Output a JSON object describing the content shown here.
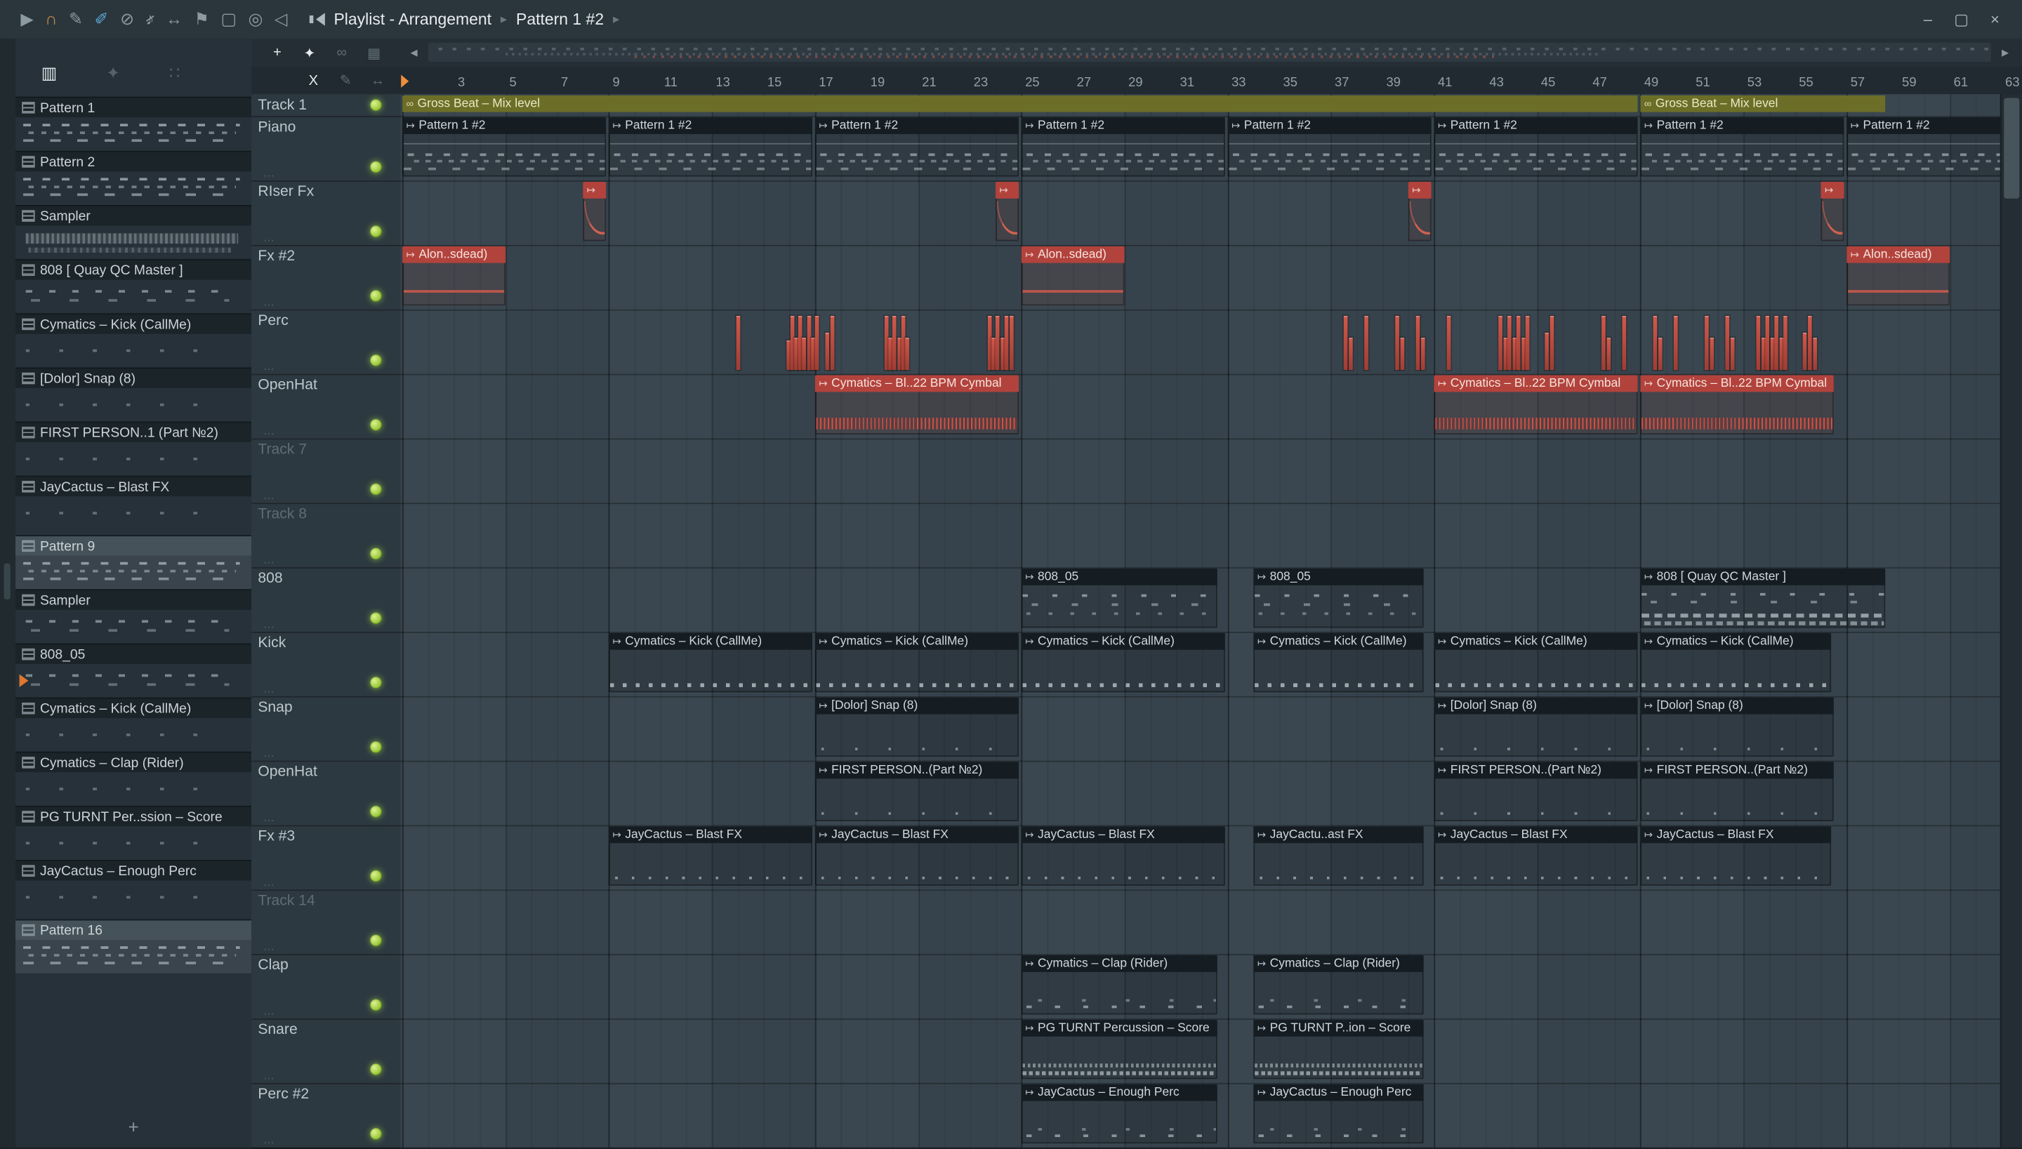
{
  "titlebar": {
    "breadcrumb": "Playlist - Arrangement",
    "crumb_sep": "▸",
    "breadcrumb2": "Pattern 1 #2",
    "tools": [
      {
        "name": "play-icon",
        "glyph": "▶",
        "color": "#8d9aa1"
      },
      {
        "name": "magnet-snap-icon",
        "glyph": "∩",
        "color": "#c78f4a"
      },
      {
        "name": "draw-tool-icon",
        "glyph": "✎",
        "color": "#8d9aa1"
      },
      {
        "name": "paint-tool-icon",
        "glyph": "✐",
        "color": "#5aa7d4",
        "bright": true
      },
      {
        "name": "delete-tool-icon",
        "glyph": "⊘",
        "color": "#8d9aa1"
      },
      {
        "name": "mute-tool-icon",
        "glyph": "♪",
        "color": "#8d9aa1",
        "slash": true
      },
      {
        "name": "slip-tool-icon",
        "glyph": "↔",
        "color": "#8d9aa1"
      },
      {
        "name": "playback-marker-icon",
        "glyph": "⚑",
        "color": "#8d9aa1"
      },
      {
        "name": "select-tool-icon",
        "glyph": "▢",
        "color": "#8d9aa1"
      },
      {
        "name": "zoom-tool-icon",
        "glyph": "◎",
        "color": "#8d9aa1"
      },
      {
        "name": "preview-speaker-icon",
        "glyph": "◁",
        "color": "#8d9aa1"
      }
    ],
    "window_buttons": [
      {
        "name": "minimize-button",
        "glyph": "–"
      },
      {
        "name": "maximize-button",
        "glyph": "▢"
      },
      {
        "name": "close-button",
        "glyph": "×"
      }
    ]
  },
  "sidebar": {
    "tools": [
      {
        "name": "pattern-grid-icon",
        "glyph": "▥",
        "bright": true
      },
      {
        "name": "star-icon",
        "glyph": "✦"
      },
      {
        "name": "more-options-icon",
        "glyph": "∷"
      }
    ],
    "add_label": "+",
    "patterns": [
      {
        "label": "Pattern 1",
        "preview": "notes-dense"
      },
      {
        "label": "Pattern 2",
        "preview": "notes-dense"
      },
      {
        "label": "Sampler",
        "preview": "wave-gray"
      },
      {
        "label": "808 [ Quay QC Master ]",
        "preview": "notes-sparse"
      },
      {
        "label": "Cymatics – Kick (CallMe)",
        "preview": "dots"
      },
      {
        "label": "[Dolor] Snap (8)",
        "preview": "dots"
      },
      {
        "label": "FIRST PERSON..1 (Part №2)",
        "preview": "dots"
      },
      {
        "label": "JayCactus – Blast FX",
        "preview": "dots"
      },
      {
        "label": "Pattern 9",
        "preview": "notes-dense",
        "selected": true,
        "gap": true
      },
      {
        "label": "Sampler",
        "preview": "notes-sparse"
      },
      {
        "label": "808_05",
        "preview": "notes-sparse",
        "playing": true
      },
      {
        "label": "Cymatics – Kick (CallMe)",
        "preview": "dots"
      },
      {
        "label": "Cymatics – Clap (Rider)",
        "preview": "dots"
      },
      {
        "label": "PG TURNT Per..ssion – Score",
        "preview": "dots"
      },
      {
        "label": "JayCactus – Enough Perc",
        "preview": "dots"
      },
      {
        "label": "Pattern 16",
        "preview": "notes-dense",
        "selected": true,
        "gap": true
      }
    ]
  },
  "playlist": {
    "tools_row1": [
      {
        "name": "add-button",
        "glyph": "+",
        "bright": true
      },
      {
        "name": "move-tool-icon",
        "glyph": "✦",
        "bright": true
      },
      {
        "name": "link-icon",
        "glyph": "∞"
      },
      {
        "name": "grid-view-icon",
        "glyph": "▦"
      }
    ],
    "tools_row2": [
      {
        "name": "cut-tool-button",
        "glyph": "X",
        "bright": true
      },
      {
        "name": "pencil-icon",
        "glyph": "✎"
      },
      {
        "name": "swap-icon",
        "glyph": "↔"
      }
    ],
    "hscroll": {
      "left_glyph": "◂",
      "right_glyph": "▸"
    },
    "ruler_numbers": [
      3,
      5,
      7,
      9,
      11,
      13,
      15,
      17,
      19,
      21,
      23,
      25,
      27,
      29,
      31,
      33,
      35,
      37,
      39,
      41,
      43,
      45,
      47,
      49,
      51,
      53,
      55,
      57,
      59,
      61,
      63
    ],
    "clip_icons": {
      "pattern": "↦",
      "audio": "↦",
      "auto": "∞"
    },
    "tracks": [
      {
        "name": "Track 1",
        "h": 17
      },
      {
        "name": "Piano"
      },
      {
        "name": "RIser Fx"
      },
      {
        "name": "Fx #2"
      },
      {
        "name": "Perc"
      },
      {
        "name": "OpenHat"
      },
      {
        "name": "Track 7",
        "dim": true
      },
      {
        "name": "Track 8",
        "dim": true
      },
      {
        "name": "808"
      },
      {
        "name": "Kick"
      },
      {
        "name": "Snap"
      },
      {
        "name": "OpenHat"
      },
      {
        "name": "Fx #3"
      },
      {
        "name": "Track 14",
        "dim": true
      },
      {
        "name": "Clap"
      },
      {
        "name": "Snare"
      },
      {
        "name": "Perc #2"
      }
    ],
    "clips": [
      {
        "t": 0,
        "type": "auto",
        "label": "Gross Beat – Mix level",
        "start": 1,
        "len": 48
      },
      {
        "t": 0,
        "type": "auto",
        "label": "Gross Beat – Mix level",
        "start": 49,
        "len": 9.6
      },
      {
        "t": 1,
        "type": "pattern",
        "label": "Pattern 1 #2",
        "start": 1,
        "len": 8,
        "deco": "piano"
      },
      {
        "t": 1,
        "type": "pattern",
        "label": "Pattern 1 #2",
        "start": 9,
        "len": 8,
        "deco": "piano"
      },
      {
        "t": 1,
        "type": "pattern",
        "label": "Pattern 1 #2",
        "start": 17,
        "len": 8,
        "deco": "piano"
      },
      {
        "t": 1,
        "type": "pattern",
        "label": "Pattern 1 #2",
        "start": 25,
        "len": 8,
        "deco": "piano"
      },
      {
        "t": 1,
        "type": "pattern",
        "label": "Pattern 1 #2",
        "start": 33,
        "len": 8,
        "deco": "piano"
      },
      {
        "t": 1,
        "type": "pattern",
        "label": "Pattern 1 #2",
        "start": 41,
        "len": 8,
        "deco": "piano"
      },
      {
        "t": 1,
        "type": "pattern",
        "label": "Pattern 1 #2",
        "start": 49,
        "len": 8,
        "deco": "piano"
      },
      {
        "t": 1,
        "type": "pattern",
        "label": "Pattern 1 #2",
        "start": 57,
        "len": 8,
        "deco": "piano"
      },
      {
        "t": 2,
        "type": "audio",
        "label": "",
        "start": 8,
        "len": 1,
        "deco": "riser"
      },
      {
        "t": 2,
        "type": "audio",
        "label": "",
        "start": 24,
        "len": 1,
        "deco": "riser"
      },
      {
        "t": 2,
        "type": "audio",
        "label": "",
        "start": 40,
        "len": 1,
        "deco": "riser"
      },
      {
        "t": 2,
        "type": "audio",
        "label": "",
        "start": 56,
        "len": 1,
        "deco": "riser"
      },
      {
        "t": 3,
        "type": "audio",
        "label": "Alon..sdead)",
        "start": 1,
        "len": 4.1,
        "deco": "fxline"
      },
      {
        "t": 3,
        "type": "audio",
        "label": "Alon..sdead)",
        "start": 25,
        "len": 4.1,
        "deco": "fxline"
      },
      {
        "t": 3,
        "type": "audio",
        "label": "Alon..sdead)",
        "start": 57,
        "len": 4.1,
        "deco": "fxline"
      },
      {
        "t": 5,
        "type": "audio",
        "label": "Cymatics – Bl..22 BPM Cymbal",
        "start": 17,
        "len": 8,
        "deco": "wave"
      },
      {
        "t": 5,
        "type": "audio",
        "label": "Cymatics – Bl..22 BPM Cymbal",
        "start": 41,
        "len": 8,
        "deco": "wave"
      },
      {
        "t": 5,
        "type": "audio",
        "label": "Cymatics – Bl..22 BPM Cymbal",
        "start": 49,
        "len": 7.6,
        "deco": "wave"
      },
      {
        "t": 8,
        "type": "pattern",
        "label": "808_05",
        "start": 25,
        "len": 7.7,
        "deco": "midi808"
      },
      {
        "t": 8,
        "type": "pattern",
        "label": "808_05",
        "start": 34,
        "len": 6.7,
        "deco": "midi808"
      },
      {
        "t": 8,
        "type": "pattern",
        "label": "808 [ Quay QC Master ]",
        "start": 49,
        "len": 9.6,
        "deco": "midi808b"
      },
      {
        "t": 9,
        "type": "pattern",
        "label": "Cymatics – Kick (CallMe)",
        "start": 9,
        "len": 8,
        "deco": "beatrow"
      },
      {
        "t": 9,
        "type": "pattern",
        "label": "Cymatics – Kick (CallMe)",
        "start": 17,
        "len": 8,
        "deco": "beatrow"
      },
      {
        "t": 9,
        "type": "pattern",
        "label": "Cymatics – Kick (CallMe)",
        "start": 25,
        "len": 8,
        "deco": "beatrow"
      },
      {
        "t": 9,
        "type": "pattern",
        "label": "Cymatics – Kick (CallMe)",
        "start": 34,
        "len": 6.7,
        "deco": "beatrow"
      },
      {
        "t": 9,
        "type": "pattern",
        "label": "Cymatics – Kick (CallMe)",
        "start": 41,
        "len": 8,
        "deco": "beatrow"
      },
      {
        "t": 9,
        "type": "pattern",
        "label": "Cymatics – Kick (CallMe)",
        "start": 49,
        "len": 7.5,
        "deco": "beatrow"
      },
      {
        "t": 10,
        "type": "pattern",
        "label": "[Dolor] Snap (8)",
        "start": 17,
        "len": 8,
        "deco": "dotsparse"
      },
      {
        "t": 10,
        "type": "pattern",
        "label": "[Dolor] Snap (8)",
        "start": 41,
        "len": 8,
        "deco": "dotsparse"
      },
      {
        "t": 10,
        "type": "pattern",
        "label": "[Dolor] Snap (8)",
        "start": 49,
        "len": 7.6,
        "deco": "dotsparse"
      },
      {
        "t": 11,
        "type": "pattern",
        "label": "FIRST PERSON..(Part №2)",
        "start": 17,
        "len": 8,
        "deco": "dotsparse"
      },
      {
        "t": 11,
        "type": "pattern",
        "label": "FIRST PERSON..(Part №2)",
        "start": 41,
        "len": 8,
        "deco": "dotsparse"
      },
      {
        "t": 11,
        "type": "pattern",
        "label": "FIRST PERSON..(Part №2)",
        "start": 49,
        "len": 7.6,
        "deco": "dotsparse"
      },
      {
        "t": 12,
        "type": "pattern",
        "label": "JayCactus – Blast FX",
        "start": 9,
        "len": 8,
        "deco": "dotrow"
      },
      {
        "t": 12,
        "type": "pattern",
        "label": "JayCactus – Blast FX",
        "start": 17,
        "len": 8,
        "deco": "dotrow"
      },
      {
        "t": 12,
        "type": "pattern",
        "label": "JayCactus – Blast FX",
        "start": 25,
        "len": 8,
        "deco": "dotrow"
      },
      {
        "t": 12,
        "type": "pattern",
        "label": "JayCactu..ast FX",
        "start": 34,
        "len": 6.7,
        "deco": "dotrow"
      },
      {
        "t": 12,
        "type": "pattern",
        "label": "JayCactus – Blast FX",
        "start": 41,
        "len": 8,
        "deco": "dotrow"
      },
      {
        "t": 12,
        "type": "pattern",
        "label": "JayCactus – Blast FX",
        "start": 49,
        "len": 7.5,
        "deco": "dotrow"
      },
      {
        "t": 14,
        "type": "pattern",
        "label": "Cymatics – Clap (Rider)",
        "start": 25,
        "len": 7.7,
        "deco": "clapdash"
      },
      {
        "t": 14,
        "type": "pattern",
        "label": "Cymatics – Clap (Rider)",
        "start": 34,
        "len": 6.7,
        "deco": "clapdash"
      },
      {
        "t": 15,
        "type": "pattern",
        "label": "PG TURNT Percussion – Score",
        "start": 25,
        "len": 7.7,
        "deco": "snaredense"
      },
      {
        "t": 15,
        "type": "pattern",
        "label": "PG TURNT P..ion – Score",
        "start": 34,
        "len": 6.7,
        "deco": "snaredense"
      },
      {
        "t": 16,
        "type": "pattern",
        "label": "JayCactus – Enough Perc",
        "start": 25,
        "len": 7.7,
        "deco": "clapdash"
      },
      {
        "t": 16,
        "type": "pattern",
        "label": "JayCactus – Enough Perc",
        "start": 34,
        "len": 6.7,
        "deco": "clapdash"
      }
    ],
    "perc_ticks": [
      [
        13.95,
        1
      ],
      [
        15.9,
        0.55
      ],
      [
        16.05,
        1
      ],
      [
        16.2,
        0.6
      ],
      [
        16.35,
        1
      ],
      [
        16.5,
        0.6
      ],
      [
        16.68,
        1
      ],
      [
        16.85,
        0.6
      ],
      [
        17.0,
        1
      ],
      [
        17.4,
        0.7
      ],
      [
        17.58,
        1
      ],
      [
        19.7,
        1
      ],
      [
        19.85,
        0.6
      ],
      [
        20.0,
        1
      ],
      [
        20.18,
        0.6
      ],
      [
        20.33,
        1
      ],
      [
        20.5,
        0.6
      ],
      [
        23.7,
        1
      ],
      [
        23.85,
        0.6
      ],
      [
        24.0,
        1
      ],
      [
        24.18,
        0.6
      ],
      [
        24.35,
        1
      ],
      [
        24.55,
        1
      ],
      [
        37.5,
        1
      ],
      [
        37.68,
        0.6
      ],
      [
        38.3,
        1
      ],
      [
        39.5,
        1
      ],
      [
        39.68,
        0.6
      ],
      [
        40.3,
        1
      ],
      [
        40.5,
        0.6
      ],
      [
        41.5,
        1
      ],
      [
        43.5,
        1
      ],
      [
        43.68,
        0.6
      ],
      [
        43.85,
        1
      ],
      [
        44.05,
        0.6
      ],
      [
        44.2,
        1
      ],
      [
        44.38,
        0.6
      ],
      [
        44.55,
        1
      ],
      [
        45.3,
        0.7
      ],
      [
        45.5,
        1
      ],
      [
        47.5,
        1
      ],
      [
        47.68,
        0.6
      ],
      [
        48.3,
        1
      ],
      [
        49.5,
        1
      ],
      [
        49.68,
        0.6
      ],
      [
        50.3,
        1
      ],
      [
        51.5,
        1
      ],
      [
        51.68,
        0.6
      ],
      [
        52.3,
        1
      ],
      [
        52.5,
        0.6
      ],
      [
        53.5,
        1
      ],
      [
        53.68,
        0.6
      ],
      [
        53.85,
        1
      ],
      [
        54.05,
        0.6
      ],
      [
        54.2,
        1
      ],
      [
        54.4,
        0.6
      ],
      [
        54.55,
        1
      ],
      [
        55.3,
        0.7
      ],
      [
        55.5,
        1
      ],
      [
        55.68,
        0.6
      ]
    ]
  }
}
